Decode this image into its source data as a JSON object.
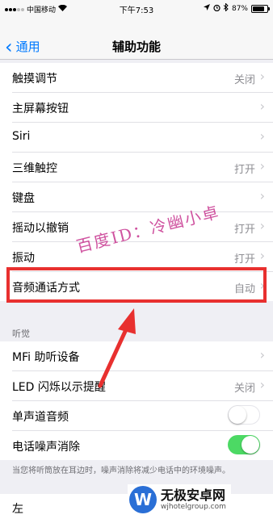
{
  "status_bar": {
    "carrier": "中国移动",
    "time": "下午7:53",
    "battery": "87%"
  },
  "nav": {
    "back_label": "通用",
    "title": "辅助功能"
  },
  "rows": [
    {
      "label": "触摸调节",
      "detail": "关闭",
      "chevron": true
    },
    {
      "label": "主屏幕按钮",
      "detail": "",
      "chevron": true
    },
    {
      "label": "Siri",
      "detail": "",
      "chevron": true
    },
    {
      "label": "三维触控",
      "detail": "打开",
      "chevron": true
    },
    {
      "label": "键盘",
      "detail": "",
      "chevron": true
    },
    {
      "label": "摇动以撤销",
      "detail": "打开",
      "chevron": true
    },
    {
      "label": "振动",
      "detail": "打开",
      "chevron": true
    },
    {
      "label": "音频通话方式",
      "detail": "自动",
      "chevron": true
    }
  ],
  "hearing": {
    "header": "听觉",
    "rows": [
      {
        "label": "MFi 助听设备",
        "detail": "",
        "chevron": true
      },
      {
        "label": "LED 闪烁以示提醒",
        "detail": "关闭",
        "chevron": true
      },
      {
        "label": "单声道音频",
        "toggle": false
      },
      {
        "label": "电话噪声消除",
        "toggle": true
      }
    ],
    "footer": "当您将听筒放在耳边时，噪声消除将减少电话中的环境噪声。"
  },
  "bottom_row": {
    "label": "左"
  },
  "watermark": "百度ID：冷幽小卓",
  "logo": {
    "mark": "W",
    "name": "无极安卓网",
    "url": "wjhotelgroup.com"
  },
  "colors": {
    "accent": "#007aff",
    "highlight": "#e8302f",
    "toggle_on": "#4cd964"
  }
}
